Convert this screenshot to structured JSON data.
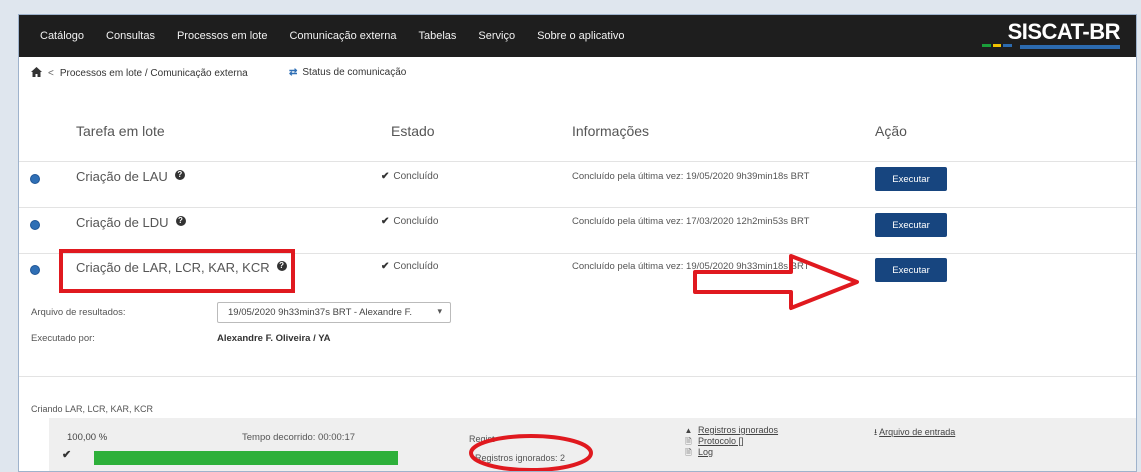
{
  "nav": {
    "items": [
      "Catálogo",
      "Consultas",
      "Processos em lote",
      "Comunicação externa",
      "Tabelas",
      "Serviço",
      "Sobre o aplicativo"
    ],
    "logo": "SISCAT-BR",
    "logo_stripe_colors": [
      "#1a9e3a",
      "#f2c200",
      "#2c6bb0"
    ]
  },
  "breadcrumb": {
    "home_icon": "home-icon",
    "separator": "<",
    "path": "Processos em lote / Comunicação externa",
    "status_link_icon": "swap-icon",
    "status_link": "Status de comunicação"
  },
  "table": {
    "headers": [
      "Tarefa em lote",
      "Estado",
      "Informações",
      "Ação"
    ],
    "rows": [
      {
        "name": "Criação de LAU",
        "state": "Concluído",
        "info": "Concluído pela última vez:  19/05/2020 9h39min18s BRT",
        "action": "Executar"
      },
      {
        "name": "Criação de LDU",
        "state": "Concluído",
        "info": "Concluído pela última vez:  17/03/2020 12h2min53s BRT",
        "action": "Executar"
      },
      {
        "name": "Criação de LAR, LCR, KAR, KCR",
        "state": "Concluído",
        "info": "Concluído pela última vez:  19/05/2020 9h33min18s BRT",
        "action": "Executar"
      }
    ]
  },
  "details": {
    "results_label": "Arquivo de resultados:",
    "results_value": "19/05/2020 9h33min37s BRT - Alexandre F.",
    "executed_by_label": "Executado por:",
    "executed_by_value": "Alexandre F. Oliveira / YA"
  },
  "process": {
    "title": "Criando LAR, LCR, KAR, KCR",
    "percent": "100,00 %",
    "progress_fraction": 1.0,
    "elapsed_label": "Tempo decorrido:  00:00:17",
    "registros_label": "Regist",
    "ignored_label": "Registros ignorados:  2",
    "links": [
      {
        "icon": "warning-icon",
        "label": "Registros ignorados"
      },
      {
        "icon": "document-icon",
        "label": "Protocolo []"
      },
      {
        "icon": "document-icon",
        "label": "Log"
      }
    ],
    "input_file_icon": "download-icon",
    "input_file_label": "Arquivo de entrada"
  },
  "annotation_color": "#e0191f"
}
